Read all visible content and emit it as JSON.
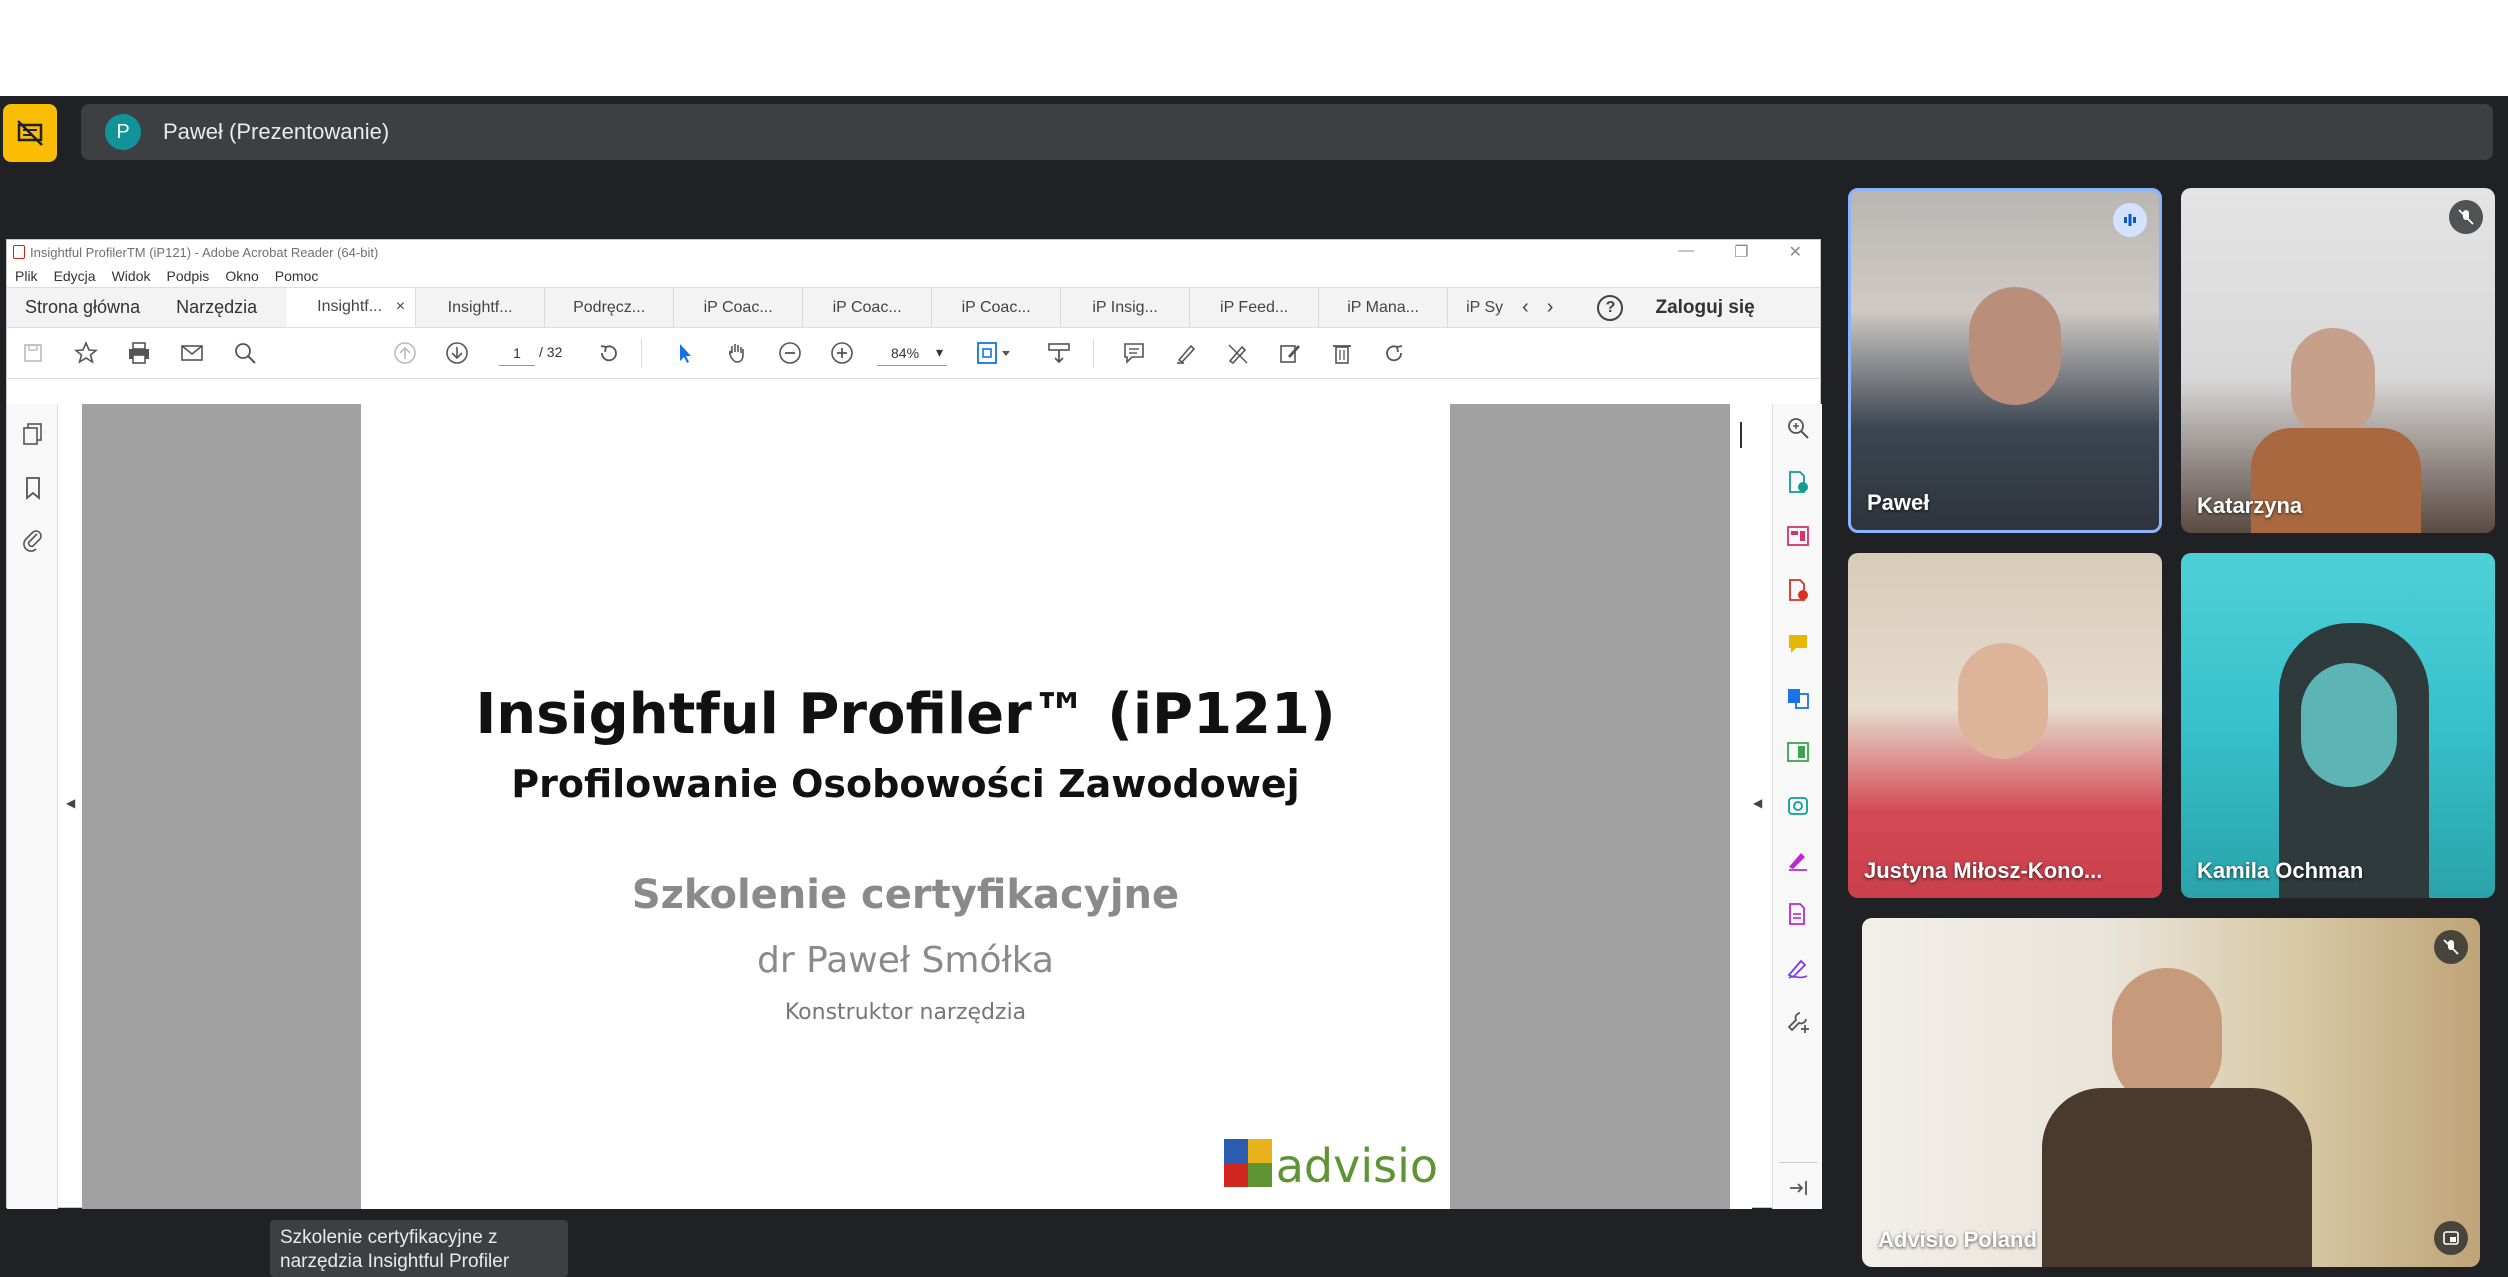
{
  "meet": {
    "presenter_initial": "P",
    "presenter_label": "Paweł (Prezentowanie)",
    "tooltip": "Szkolenie certyfikacyjne z narzędzia Insightful Profiler",
    "participants": [
      {
        "name": "Paweł",
        "speaking": true,
        "muted": false
      },
      {
        "name": "Katarzyna",
        "speaking": false,
        "muted": true
      },
      {
        "name": "Justyna Miłosz-Kono...",
        "speaking": false,
        "muted": false
      },
      {
        "name": "Kamila Ochman",
        "speaking": false,
        "muted": false
      },
      {
        "name": "Advisio Poland",
        "speaking": false,
        "muted": true
      }
    ],
    "colors": {
      "background": "#202124",
      "present_button": "#fbbc04",
      "bar": "#3c4043",
      "avatar": "#12939a",
      "active_border": "#8ab4f8"
    }
  },
  "acrobat": {
    "window_title": "Insightful ProfilerTM (iP121) - Adobe Acrobat Reader (64-bit)",
    "menu": [
      "Plik",
      "Edycja",
      "Widok",
      "Podpis",
      "Okno",
      "Pomoc"
    ],
    "home_tab": "Strona główna",
    "tools_tab": "Narzędzia",
    "doc_tabs": [
      "Insightf...",
      "Insightf...",
      "Podręcz...",
      "iP Coac...",
      "iP Coac...",
      "iP Coac...",
      "iP Insig...",
      "iP Feed...",
      "iP Mana...",
      "iP Sy"
    ],
    "tab_close": "×",
    "help": "?",
    "signin": "Zaloguj się",
    "page_current": "1",
    "page_total": "/ 32",
    "zoom": "84%",
    "zoom_arrow": "▾",
    "nav_prev": "‹",
    "nav_next": "›"
  },
  "slide": {
    "title": "Insightful Profiler™ (iP121)",
    "subtitle": "Profilowanie Osobowości Zawodowej",
    "course": "Szkolenie certyfikacyjne",
    "author": "dr Paweł Smółka",
    "role": "Konstruktor narzędzia",
    "logo_text": "advisio",
    "logo_colors": [
      "#2a5db0",
      "#e8b21c",
      "#d1261f",
      "#5f9432"
    ]
  }
}
